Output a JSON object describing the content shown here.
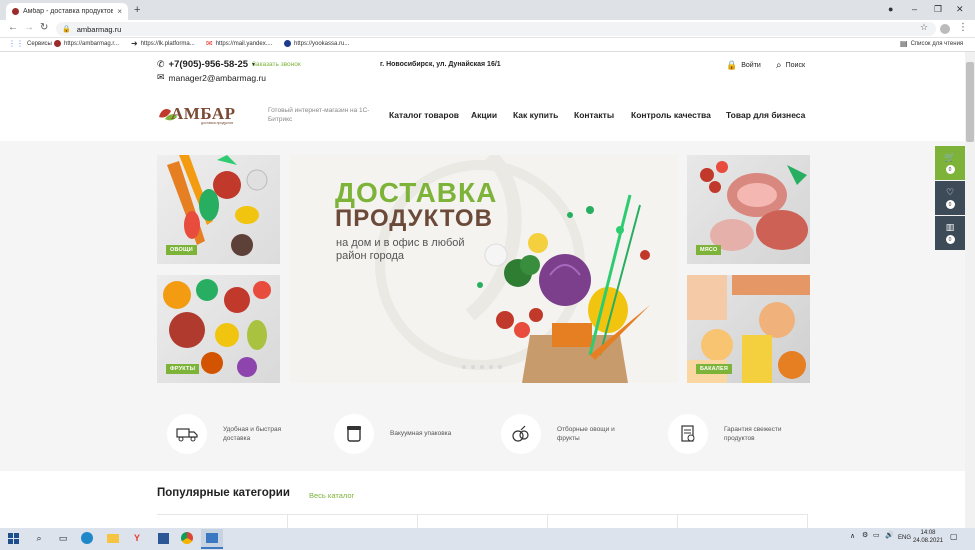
{
  "browser": {
    "tab_title": "Амбар - доставка продуктов п...",
    "new_tab": "+",
    "url": "ambarmag.ru",
    "bookmarks": [
      {
        "label": "Сервисы",
        "color": "#4285f4"
      },
      {
        "label": "https://ambarmag.r...",
        "color": "#9b2c2c"
      },
      {
        "label": "https://lk.platforma...",
        "color": "#333333"
      },
      {
        "label": "https://mail.yandex....",
        "color": "#e53935"
      },
      {
        "label": "https://yookassa.ru...",
        "color": "#1e3a8a"
      }
    ],
    "reading_list": "Список для чтения"
  },
  "header": {
    "phone": "+7(905)-956-58-25",
    "phone_caret": "▾",
    "callback": "Заказать звонок",
    "email": "manager2@ambarmag.ru",
    "address": "г. Новосибирск, ул. Дунайская 16/1",
    "login": "Войти",
    "search": "Поиск",
    "logo_text": "АМБАР",
    "logo_sub": "доставка продуктов",
    "tagline": "Готовый интернет-магазин на 1С-Битрикс"
  },
  "nav": [
    "Каталог товаров",
    "Акции",
    "Как купить",
    "Контакты",
    "Контроль качества",
    "Товар для бизнеса"
  ],
  "tiles": {
    "vegetables": "ОВОЩИ",
    "fruits": "ФРУКТЫ",
    "meat": "МЯСО",
    "grocery": "БАКАЛЕЯ"
  },
  "banner": {
    "title1": "ДОСТАВКА",
    "title2": "ПРОДУКТОВ",
    "subtitle": "на дом и в офис в любой район города"
  },
  "features": [
    {
      "text": "Удобная и быстрая доставка",
      "icon": "truck-icon"
    },
    {
      "text": "Вакуумная упаковка",
      "icon": "package-icon"
    },
    {
      "text": "Отборные овощи и фрукты",
      "icon": "produce-icon"
    },
    {
      "text": "Гарантия свежести продуктов",
      "icon": "certificate-icon"
    }
  ],
  "side_panel": {
    "cart": "0",
    "favorites": "0",
    "compare": "0"
  },
  "popular": {
    "title": "Популярные категории",
    "all_link": "Весь каталог"
  },
  "taskbar": {
    "lang": "ENG",
    "time": "14:08",
    "date": "24.08.2021"
  },
  "colors": {
    "accent": "#7db339",
    "dark_panel": "#3d4a57",
    "brown": "#6b4a3a"
  }
}
